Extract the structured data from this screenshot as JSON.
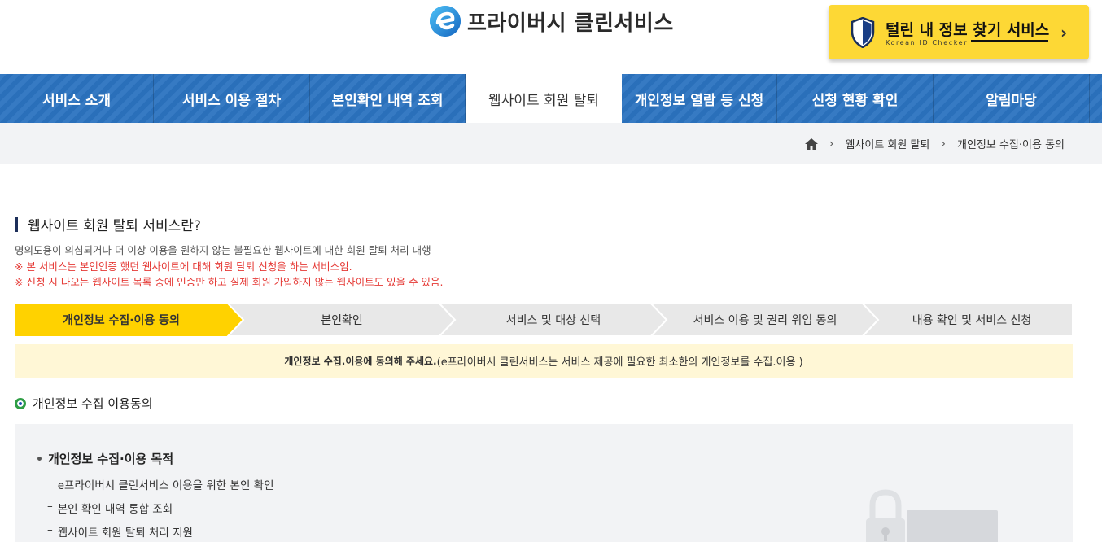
{
  "header": {
    "logo_text": "프라이버시 클린서비스",
    "promo": {
      "title": "털린 내 정보 찾기 서비스",
      "subtitle": "Korean ID Checker",
      "chevron": "›"
    }
  },
  "nav": {
    "items": [
      {
        "label": "서비스 소개"
      },
      {
        "label": "서비스 이용 절차"
      },
      {
        "label": "본인확인 내역 조회"
      },
      {
        "label": "웹사이트 회원 탈퇴"
      },
      {
        "label": "개인정보 열람 등 신청"
      },
      {
        "label": "신청 현황 확인"
      },
      {
        "label": "알림마당"
      }
    ],
    "active_index": 3
  },
  "breadcrumb": {
    "items": [
      "웹사이트 회원 탈퇴",
      "개인정보 수집·이용 동의"
    ],
    "separator": "›"
  },
  "section": {
    "title": "웹사이트 회원 탈퇴 서비스란?",
    "description": "명의도용이 의심되거나 더 이상 이용을 원하지 않는 불필요한 웹사이트에 대한 회원 탈퇴 처리 대행",
    "notes": [
      "※ 본 서비스는 본인인증 했던 웹사이트에 대해 회원 탈퇴 신청을 하는 서비스임.",
      "※ 신청 시 나오는 웹사이트 목록 중에 인증만 하고 실제 회원 가입하지 않는 웹사이트도 있을 수 있음."
    ]
  },
  "steps": {
    "items": [
      "개인정보 수집·이용 동의",
      "본인확인",
      "서비스 및 대상 선택",
      "서비스 이용 및 권리 위임 동의",
      "내용 확인 및 서비스 신청"
    ],
    "active_index": 0
  },
  "notice": {
    "bold": "개인정보 수집.이용에 동의해 주세요.",
    "rest": "(e프라이버시 클린서비스는 서비스 제공에 필요한 최소한의 개인정보를 수집.이용 )"
  },
  "consent": {
    "heading": "개인정보 수집 이용동의",
    "purpose_title": "개인정보 수집·이용 목적",
    "purposes": [
      "e프라이버시 클린서비스 이용을 위한 본인 확인",
      "본인 확인 내역 통합 조회",
      "웹사이트 회원 탈퇴 처리 지원"
    ],
    "dash": "–"
  },
  "colors": {
    "nav_blue": "#2b73c0",
    "promo_yellow": "#fdd835",
    "step_active": "#ffd200",
    "step_inactive": "#e8e8e8",
    "notice_bg": "#fff7d6",
    "note_red": "#e53935"
  }
}
